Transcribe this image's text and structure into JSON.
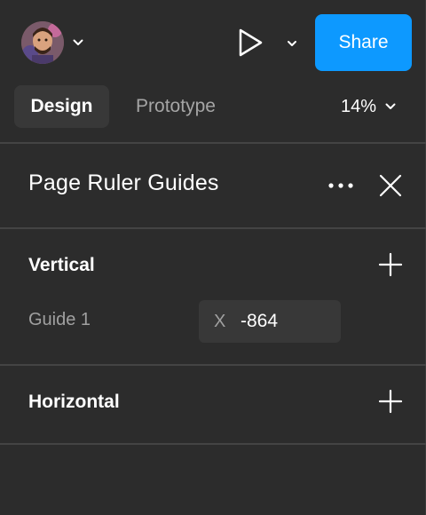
{
  "header": {
    "avatar_icon": "user-avatar",
    "share_label": "Share",
    "accent_color": "#0d99ff"
  },
  "tabs": {
    "design_label": "Design",
    "prototype_label": "Prototype",
    "zoom_label": "14%"
  },
  "panel": {
    "title": "Page Ruler Guides",
    "more_icon": "more-icon",
    "close_icon": "close-icon",
    "vertical": {
      "label": "Vertical",
      "guides": [
        {
          "name": "Guide 1",
          "axis": "X",
          "value": "-864"
        }
      ]
    },
    "horizontal": {
      "label": "Horizontal"
    }
  }
}
